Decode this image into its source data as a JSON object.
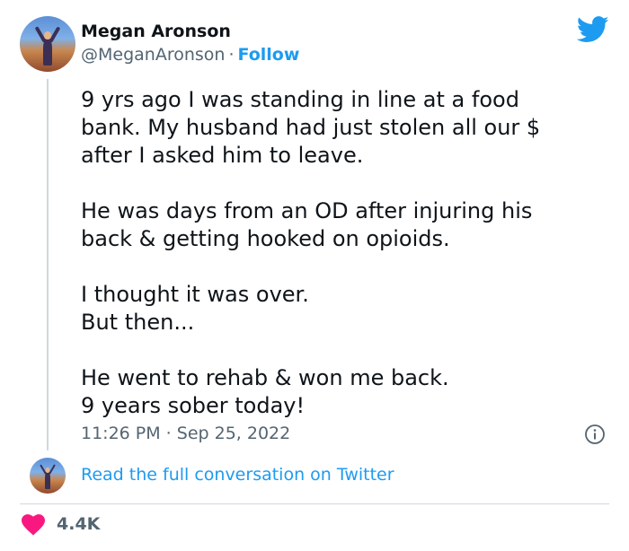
{
  "author": {
    "name": "Megan Aronson",
    "handle": "@MeganAronson",
    "separator": "·",
    "follow_label": "Follow"
  },
  "tweet": {
    "paragraphs": [
      [
        "9 yrs ago I was standing in line at a food",
        "bank. My husband had just stolen all our $",
        "after I asked him to leave."
      ],
      [
        "He was days from an OD after injuring his",
        "back & getting hooked on opioids."
      ],
      [
        "I thought it was over.",
        "But then..."
      ],
      [
        "He went to rehab & won me back.",
        "9 years sober today!"
      ]
    ],
    "timestamp": "11:26 PM · Sep 25, 2022"
  },
  "read_more_label": "Read the full conversation on Twitter",
  "likes": "4.4K",
  "icons": {
    "brand": "twitter-bird-icon",
    "info": "info-icon",
    "like": "heart-icon"
  },
  "colors": {
    "accent": "#1d9bf0",
    "like": "#f91880",
    "muted": "#536471"
  }
}
